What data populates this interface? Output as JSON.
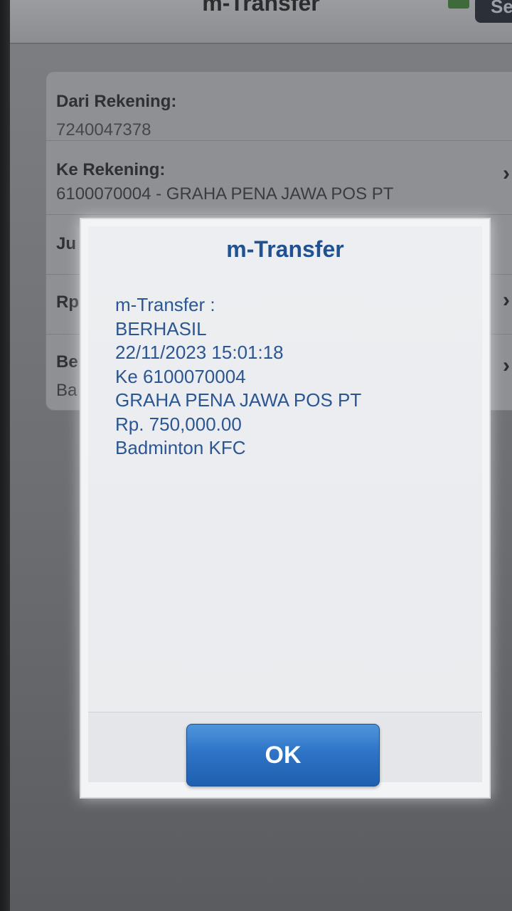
{
  "header": {
    "title": "m-Transfer",
    "right_button_label": "Se"
  },
  "form": {
    "from_account": {
      "label": "Dari Rekening:",
      "value": "7240047378"
    },
    "to_account": {
      "label": "Ke Rekening:",
      "value": "6100070004 - GRAHA PENA JAWA POS PT"
    },
    "amount_label_partial": "Ju",
    "currency_partial": "Rp",
    "note": {
      "label_partial": "Be",
      "value_partial": "Ba"
    }
  },
  "dialog": {
    "title": "m-Transfer",
    "lines": [
      "m-Transfer :",
      "BERHASIL",
      "22/11/2023 15:01:18",
      "Ke 6100070004",
      "GRAHA PENA JAWA POS PT",
      "Rp. 750,000.00",
      "Badminton KFC"
    ],
    "ok_label": "OK"
  },
  "icons": {
    "chevron": "chevron-right-icon"
  },
  "colors": {
    "dialog_text": "#2c5691",
    "dialog_title": "#21518f",
    "ok_button": "#2e74c7"
  }
}
